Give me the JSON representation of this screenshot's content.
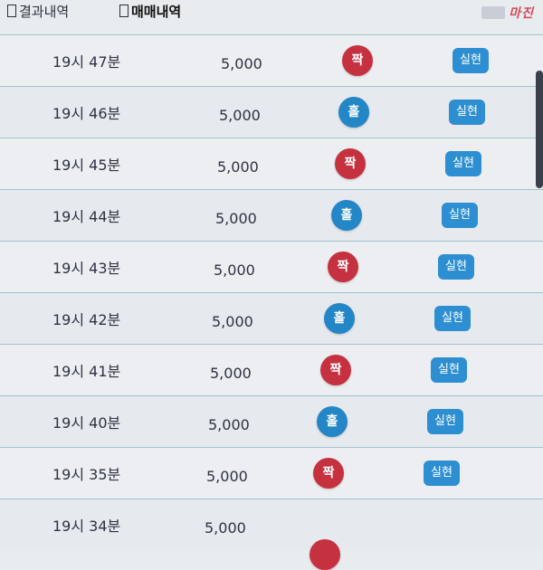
{
  "tabs": [
    {
      "label": "결과내역",
      "active": false
    },
    {
      "label": "매매내역",
      "active": true
    }
  ],
  "watermark": "마진",
  "rows": [
    {
      "time": "19시 47분",
      "amount": "5,000",
      "result": "짝",
      "color": "red",
      "status": "실현"
    },
    {
      "time": "19시 46분",
      "amount": "5,000",
      "result": "홀",
      "color": "blue",
      "status": "실현"
    },
    {
      "time": "19시 45분",
      "amount": "5,000",
      "result": "짝",
      "color": "red",
      "status": "실현"
    },
    {
      "time": "19시 44분",
      "amount": "5,000",
      "result": "홀",
      "color": "blue",
      "status": "실현"
    },
    {
      "time": "19시 43분",
      "amount": "5,000",
      "result": "짝",
      "color": "red",
      "status": "실현"
    },
    {
      "time": "19시 42분",
      "amount": "5,000",
      "result": "홀",
      "color": "blue",
      "status": "실현"
    },
    {
      "time": "19시 41분",
      "amount": "5,000",
      "result": "짝",
      "color": "red",
      "status": "실현"
    },
    {
      "time": "19시 40분",
      "amount": "5,000",
      "result": "홀",
      "color": "blue",
      "status": "실현"
    },
    {
      "time": "19시 35분",
      "amount": "5,000",
      "result": "짝",
      "color": "red",
      "status": "실현"
    },
    {
      "time": "19시 34분",
      "amount": "5,000",
      "result": "",
      "color": "red",
      "status": ""
    }
  ]
}
